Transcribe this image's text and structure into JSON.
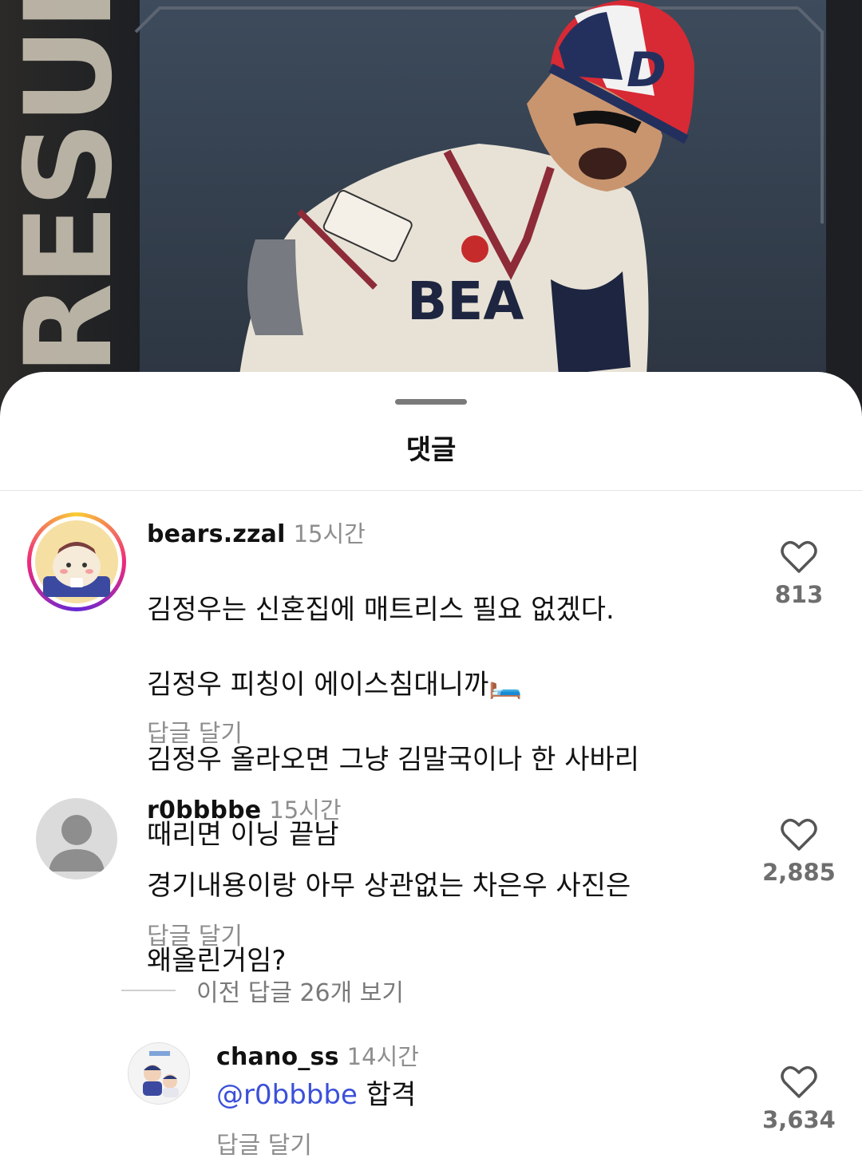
{
  "sheet": {
    "title": "댓글"
  },
  "post_image": {
    "banner_text": "RESULT"
  },
  "comments": [
    {
      "username": "bears.zzal",
      "time": "15시간",
      "lines": [
        "김정우는 신혼집에 매트리스 필요 없겠다.",
        "김정우 피칭이 에이스침대니까🛏️",
        "김정우 올라오면 그냥 김말국이나 한 사바리",
        "때리면 이닝 끝남"
      ],
      "reply_label": "답글 달기",
      "likes": "813",
      "avatar": "bear-cartoon-avatar",
      "has_story_ring": true
    },
    {
      "username": "r0bbbbe",
      "time": "15시간",
      "lines": [
        "경기내용이랑 아무 상관없는 차은우 사진은",
        "왜올린거임?"
      ],
      "reply_label": "답글 달기",
      "likes": "2,885",
      "avatar": "default-person-avatar",
      "has_story_ring": false
    }
  ],
  "view_replies": {
    "label": "이전 답글 26개 보기"
  },
  "reply": {
    "username": "chano_ss",
    "time": "14시간",
    "mention": "@r0bbbbe",
    "text": " 합격",
    "reply_label": "답글 달기",
    "likes": "3,634",
    "avatar": "cartoon-players-avatar"
  },
  "colors": {
    "mention": "#3b50d9",
    "meta": "#8e8e8e",
    "ring_start": "#f9ce34",
    "ring_mid": "#ee2a7b",
    "ring_end": "#6228d7"
  }
}
